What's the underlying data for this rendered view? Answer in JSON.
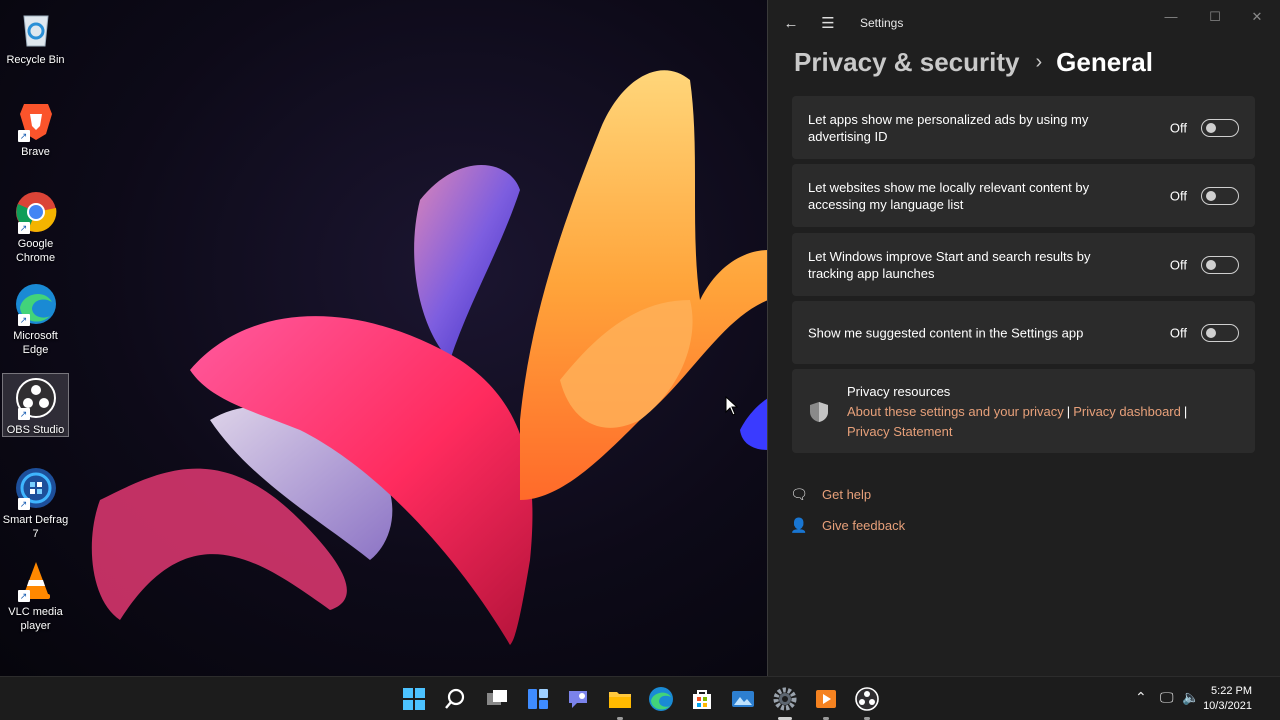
{
  "desktop": {
    "icons": [
      {
        "label": "Recycle Bin",
        "icon": "recycle-bin-icon"
      },
      {
        "label": "Brave",
        "icon": "brave-icon"
      },
      {
        "label": "Google Chrome",
        "icon": "chrome-icon"
      },
      {
        "label": "Microsoft Edge",
        "icon": "edge-icon"
      },
      {
        "label": "OBS Studio",
        "icon": "obs-icon",
        "selected": true
      },
      {
        "label": "Smart Defrag 7",
        "icon": "smart-defrag-icon"
      },
      {
        "label": "VLC media player",
        "icon": "vlc-icon"
      }
    ]
  },
  "settings": {
    "app_title": "Settings",
    "back_icon": "back-arrow-icon",
    "menu_icon": "hamburger-menu-icon",
    "window_controls": [
      "minimize",
      "maximize",
      "close"
    ],
    "breadcrumb": {
      "parent": "Privacy & security",
      "separator": "›",
      "current": "General"
    },
    "options": [
      {
        "text": "Let apps show me personalized ads by using my advertising ID",
        "state": "Off"
      },
      {
        "text": "Let websites show me locally relevant content by accessing my language list",
        "state": "Off"
      },
      {
        "text": "Let Windows improve Start and search results by tracking app launches",
        "state": "Off"
      },
      {
        "text": "Show me suggested content in the Settings app",
        "state": "Off"
      }
    ],
    "resources": {
      "title": "Privacy resources",
      "icon": "shield-icon",
      "links": [
        "About these settings and your privacy",
        "Privacy dashboard",
        "Privacy Statement"
      ],
      "separator": "|"
    },
    "help": {
      "label": "Get help",
      "icon": "help-chat-icon"
    },
    "feedback": {
      "label": "Give feedback",
      "icon": "feedback-person-icon"
    },
    "colors": {
      "accent_link": "#e7a07a",
      "card": "#2b2b2b",
      "window": "#1f1f1f"
    }
  },
  "taskbar": {
    "apps": [
      "start-icon",
      "search-icon",
      "task-view-icon",
      "widgets-icon",
      "chat-icon",
      "file-explorer-icon",
      "edge-icon",
      "store-icon",
      "photos-icon",
      "settings-gear-icon",
      "media-player-icon",
      "obs-icon"
    ],
    "time": "5:22 PM",
    "date": "10/3/2021"
  }
}
